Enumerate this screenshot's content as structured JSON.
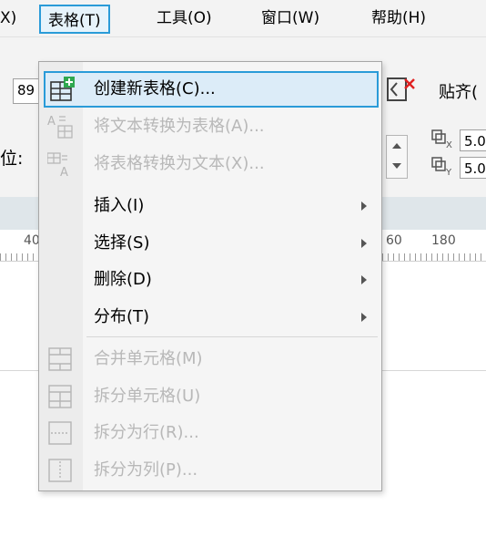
{
  "menubar": {
    "items": [
      {
        "label": "X)",
        "id": "x-partial"
      },
      {
        "label": "表格(T)",
        "id": "table",
        "active": true
      },
      {
        "label": "工具(O)",
        "id": "tools"
      },
      {
        "label": "窗口(W)",
        "id": "window"
      },
      {
        "label": "帮助(H)",
        "id": "help"
      }
    ]
  },
  "toolbar": {
    "zoom_partial": "89",
    "snap_label": "贴齐(",
    "position_label": "位:",
    "offset_x": "5.0",
    "offset_y": "5.0"
  },
  "ruler": {
    "ticks": [
      "40",
      "60",
      "180"
    ]
  },
  "menu": {
    "items": [
      {
        "label": "创建新表格(C)...",
        "enabled": true,
        "highlight": true,
        "icon": "create-table-icon"
      },
      {
        "label": "将文本转换为表格(A)...",
        "enabled": false,
        "icon": "text-to-table-icon"
      },
      {
        "label": "将表格转换为文本(X)...",
        "enabled": false,
        "icon": "table-to-text-icon"
      },
      {
        "label": "插入(I)",
        "enabled": true,
        "submenu": true
      },
      {
        "label": "选择(S)",
        "enabled": true,
        "submenu": true
      },
      {
        "label": "删除(D)",
        "enabled": true,
        "submenu": true
      },
      {
        "label": "分布(T)",
        "enabled": true,
        "submenu": true
      },
      {
        "label": "合并单元格(M)",
        "enabled": false,
        "icon": "merge-cells-icon"
      },
      {
        "label": "拆分单元格(U)",
        "enabled": false,
        "icon": "split-cells-icon"
      },
      {
        "label": "拆分为行(R)...",
        "enabled": false,
        "icon": "split-rows-icon"
      },
      {
        "label": "拆分为列(P)...",
        "enabled": false,
        "icon": "split-columns-icon"
      }
    ]
  },
  "colors": {
    "accent": "#2a9bd8",
    "highlight_bg": "#dcecf8",
    "disabled_text": "#b8b8b8"
  }
}
